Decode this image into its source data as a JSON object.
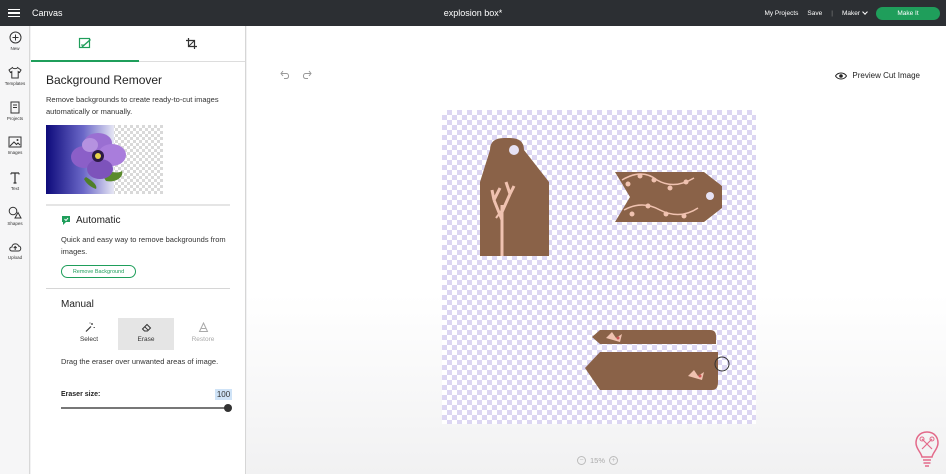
{
  "topbar": {
    "app_name": "Canvas",
    "project_title": "explosion box*",
    "my_projects": "My Projects",
    "save": "Save",
    "separator": "|",
    "machine": "Maker",
    "make_it": "Make It"
  },
  "leftnav": {
    "items": [
      {
        "label": "New",
        "icon": "plus-circle-icon"
      },
      {
        "label": "Templates",
        "icon": "shirt-icon"
      },
      {
        "label": "Projects",
        "icon": "projects-icon"
      },
      {
        "label": "Images",
        "icon": "image-icon"
      },
      {
        "label": "Text",
        "icon": "text-icon"
      },
      {
        "label": "Shapes",
        "icon": "shapes-icon"
      },
      {
        "label": "Upload",
        "icon": "upload-icon"
      }
    ]
  },
  "panel": {
    "title": "Background Remover",
    "description": "Remove backgrounds to create ready-to-cut images automatically or manually.",
    "automatic": {
      "title": "Automatic",
      "description": "Quick and easy way to remove backgrounds from images.",
      "button": "Remove Background"
    },
    "manual": {
      "title": "Manual",
      "tools": [
        {
          "label": "Select",
          "icon": "magic-wand-icon",
          "state": "normal"
        },
        {
          "label": "Erase",
          "icon": "eraser-icon",
          "state": "active"
        },
        {
          "label": "Restore",
          "icon": "restore-icon",
          "state": "disabled"
        }
      ],
      "description": "Drag the eraser over unwanted areas of image.",
      "eraser_label": "Eraser size:",
      "eraser_value": "100",
      "eraser_level": 1.0
    }
  },
  "canvas": {
    "preview_label": "Preview Cut Image",
    "zoom_label": "15%",
    "zoom_minus": "−",
    "zoom_plus": "+"
  },
  "colors": {
    "accent": "#1f9e5b",
    "topbar": "#2c2f33",
    "tag_brown": "#8a6248",
    "tag_pink": "#f0c2b0",
    "checker": "#dcd6f2"
  }
}
